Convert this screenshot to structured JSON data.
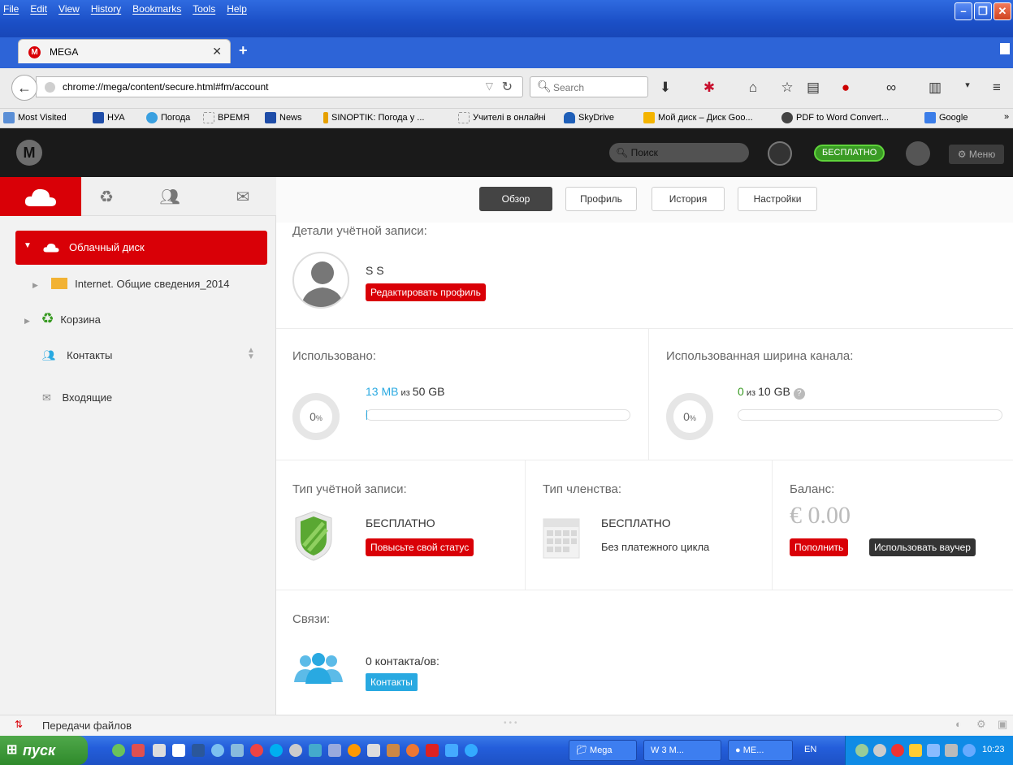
{
  "browser": {
    "menus": [
      "File",
      "Edit",
      "View",
      "History",
      "Bookmarks",
      "Tools",
      "Help"
    ],
    "tab_title": "MEGA",
    "url": "chrome://mega/content/secure.html#fm/account",
    "search_placeholder": "Search",
    "bookmarks": [
      "Most Visited",
      "НУА",
      "Погода",
      "ВРЕМЯ",
      "News",
      "SINOPTIK: Погода у ...",
      "Учителі в онлайні",
      "SkyDrive",
      "Мой диск – Диск Goo...",
      "PDF to Word Convert...",
      "Google"
    ]
  },
  "mega": {
    "logo": "M",
    "search_placeholder": "Поиск",
    "plan_badge": "БЕСПЛАТНО",
    "menu_label": "Меню",
    "tabs": [
      "Обзор",
      "Профиль",
      "История",
      "Настройки"
    ],
    "sidebar": {
      "cloud_drive": "Облачный диск",
      "folder": "Internet. Общие сведения_2014",
      "trash": "Корзина",
      "contacts": "Контакты",
      "inbox": "Входящие"
    },
    "account": {
      "details_title": "Детали учётной записи:",
      "user_name": "S S",
      "edit_profile": "Редактировать профиль",
      "used_title": "Использовано:",
      "used_pct": "0",
      "used_value": "13 MB",
      "used_of": "из",
      "used_total": "50 GB",
      "used_fraction": 0.0003,
      "bandwidth_title": "Использованная ширина канала:",
      "bw_pct": "0",
      "bw_value": "0",
      "bw_of": "из",
      "bw_total": "10 GB",
      "bw_fraction": 0,
      "pct_sign": "%",
      "account_type_title": "Тип учётной записи:",
      "account_type": "БЕСПЛАТНО",
      "upgrade": "Повысьте свой статус",
      "membership_title": "Тип членства:",
      "membership_type": "БЕСПЛАТНО",
      "membership_cycle": "Без платежного цикла",
      "balance_title": "Баланс:",
      "balance": "€ 0.00",
      "topup": "Пополнить",
      "voucher": "Использовать ваучер",
      "connections_title": "Связи:",
      "contacts_count": "0 контакта/ов:",
      "contacts_btn": "Контакты"
    },
    "transfers": "Передачи файлов"
  },
  "taskbar": {
    "start": "пуск",
    "tasks": [
      "Mega",
      "3 M...",
      "ME..."
    ],
    "lang": "EN",
    "time": "10:23"
  },
  "colors": {
    "mega_red": "#d90007",
    "free_green": "#3a9b24",
    "link_blue": "#29a9e1"
  }
}
